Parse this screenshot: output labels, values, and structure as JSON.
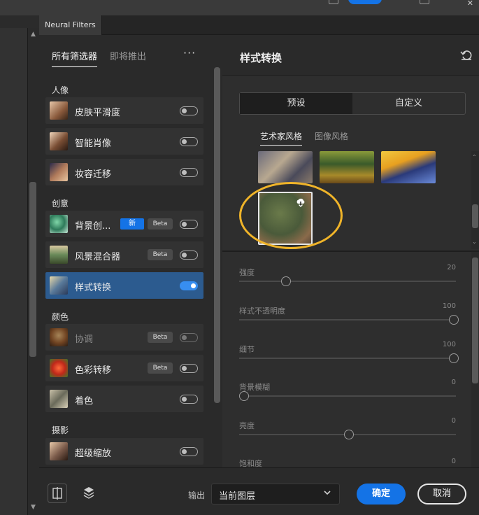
{
  "panel_tab": "Neural Filters",
  "list": {
    "tabs": [
      "所有筛选器",
      "即将推出"
    ],
    "more": "···",
    "sections": [
      {
        "title": "人像",
        "items": [
          {
            "label": "皮肤平滑度",
            "icon": "portrait-skin-thumb",
            "enabled": false
          },
          {
            "label": "智能肖像",
            "icon": "portrait-smart-thumb",
            "enabled": false
          },
          {
            "label": "妆容迁移",
            "icon": "makeup-thumb",
            "enabled": false
          }
        ]
      },
      {
        "title": "创意",
        "items": [
          {
            "label": "背景创...",
            "icon": "background-thumb",
            "badge_new": "新",
            "badge_beta": "Beta",
            "enabled": false
          },
          {
            "label": "风景混合器",
            "icon": "landscape-thumb",
            "badge_beta": "Beta",
            "enabled": false
          },
          {
            "label": "样式转换",
            "icon": "style-transfer-thumb",
            "enabled": true,
            "selected": true
          }
        ]
      },
      {
        "title": "颜色",
        "items": [
          {
            "label": "协调",
            "icon": "harmonize-thumb",
            "badge_beta": "Beta",
            "enabled": false,
            "dim": true
          },
          {
            "label": "色彩转移",
            "icon": "color-transfer-thumb",
            "badge_beta": "Beta",
            "enabled": false
          },
          {
            "label": "着色",
            "icon": "colorize-thumb",
            "enabled": false
          }
        ]
      },
      {
        "title": "摄影",
        "items": [
          {
            "label": "超级缩放",
            "icon": "super-zoom-thumb",
            "enabled": false
          }
        ]
      }
    ]
  },
  "detail": {
    "title": "样式转换",
    "segments": [
      "预设",
      "自定义"
    ],
    "subtabs": [
      "艺术家风格",
      "图像风格"
    ],
    "sliders": [
      {
        "label": "强度",
        "value": "20",
        "pos": 0.2
      },
      {
        "label": "样式不透明度",
        "value": "100",
        "pos": 1.0
      },
      {
        "label": "细节",
        "value": "100",
        "pos": 1.0
      },
      {
        "label": "背景模糊",
        "value": "0",
        "pos": 0.0
      },
      {
        "label": "亮度",
        "value": "0",
        "pos": 0.5
      },
      {
        "label": "饱和度",
        "value": "0",
        "pos": 0.5
      }
    ]
  },
  "footer": {
    "output_label": "输出",
    "output_value": "当前图层",
    "ok": "确定",
    "cancel": "取消"
  },
  "colors": {
    "accent": "#1473e6",
    "highlight_ring": "#f0b429",
    "selected_row": "#2c5b8f"
  }
}
